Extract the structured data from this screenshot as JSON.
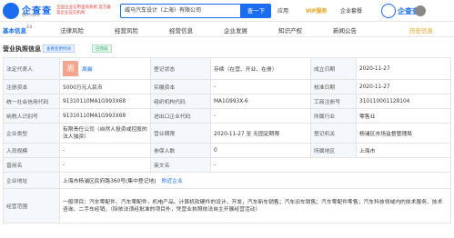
{
  "header": {
    "logo_text": "企查查",
    "logo_sub": "Qcc.com",
    "slogan": "全国企业信用查询系统\n官方备案企业征信机构",
    "search_value": "威马汽车设计（上海）有限公司",
    "search_button": "查一下",
    "nav": [
      "应用",
      "VIP服务",
      "企业套餐"
    ],
    "watermark": "企查查"
  },
  "tabs": [
    {
      "label": "基本信息",
      "count": "23"
    },
    {
      "label": "法律风险",
      "count": ""
    },
    {
      "label": "经营风险",
      "count": ""
    },
    {
      "label": "经营信息",
      "count": ""
    },
    {
      "label": "企业发展",
      "count": ""
    },
    {
      "label": "知识产权",
      "count": ""
    },
    {
      "label": "新闻公告",
      "count": ""
    },
    {
      "label": "历史信息",
      "count": ""
    }
  ],
  "section": {
    "title": "营业执照信息",
    "tag_blue": "查看变更时间",
    "tag_green": "已完成"
  },
  "table": {
    "legal_rep_label": "法定代表人",
    "legal_rep_avatar": "周",
    "legal_rep_name": "周晨",
    "status_label": "登记状态",
    "status_value": "存续（在营、开业、在册）",
    "founded_label": "成立日期",
    "founded_value": "2020-11-27",
    "reg_cap_label": "注册资本",
    "reg_cap_value": "5000万元人民币",
    "paid_cap_label": "实缴资本",
    "paid_cap_value": "-",
    "approve_label": "核准日期",
    "approve_value": "2020-11-27",
    "credit_code_label": "统一社会信用代码",
    "credit_code_value": "91310110MA1G993X68",
    "org_code_label": "组织机构代码",
    "org_code_value": "MA1G993X-6",
    "biz_reg_label": "工商注册号",
    "biz_reg_value": "310110001128104",
    "tax_label": "纳税人识别号",
    "tax_value": "91310110MA1G993X68",
    "import_label": "进出口企业代码",
    "import_value": "-",
    "industry_label": "所属行业",
    "industry_value": "零售业",
    "type_label": "企业类型",
    "type_value": "有限责任公司（自然人投资或控股的法人独资）",
    "term_label": "营业期限",
    "term_value": "2020-11-27 至 无固定期限",
    "authority_label": "登记机关",
    "authority_value": "杨浦区市场监督管理局",
    "staff_label": "人员规模",
    "staff_value": "-",
    "insured_label": "参保人数",
    "insured_value": "0",
    "region_label": "所属地区",
    "region_value": "上海市",
    "former_label": "曾用名",
    "former_value": "-",
    "english_label": "英文名",
    "english_value": "-",
    "address_label": "企业地址",
    "address_value": "上海市杨浦区民府路360号(集中登记地)",
    "address_link": "附近企业",
    "scope_label": "经营范围",
    "scope_value": "一般项目：汽车零配件、汽车零配件，机电产品、计算机软硬件的设计、开发，汽车新车销售；汽车旧车销售；汽车零配件零售；汽车科技领域内的技术服务、技术咨询、二手车经销。（除依法须经批准的项目外，凭营业执照依法自主开展经营活动）"
  },
  "colors": {
    "brand": "#1a6cf0",
    "vip": "#e8a21a",
    "label_bg": "#f4f7fb"
  }
}
